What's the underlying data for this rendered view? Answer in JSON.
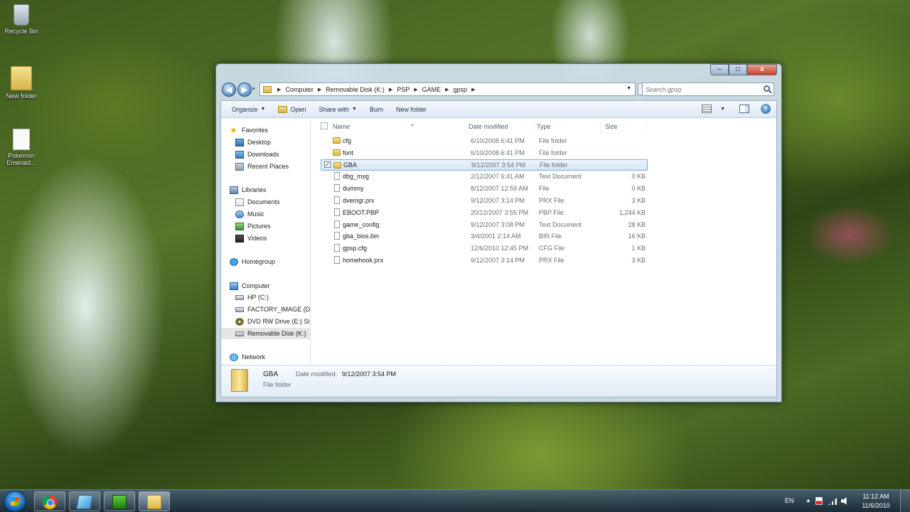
{
  "desktop": {
    "icons": [
      {
        "label": "Recycle Bin"
      },
      {
        "label": "New folder"
      },
      {
        "label": "Pokemon Emerald..."
      }
    ]
  },
  "window": {
    "controls": {
      "minimize": "–",
      "maximize": "□",
      "close": "x"
    },
    "nav": {
      "back": "◀",
      "forward": "▶",
      "recent": "▾"
    },
    "breadcrumb": [
      "Computer",
      "Removable Disk (K:)",
      "PSP",
      "GAME",
      "gpsp"
    ],
    "search_placeholder": "Search gpsp",
    "toolbar": {
      "organize": "Organize",
      "open": "Open",
      "share_with": "Share with",
      "burn": "Burn",
      "new_folder": "New folder",
      "help": "?"
    },
    "nav_pane": {
      "favorites": "Favorites",
      "desktop": "Desktop",
      "downloads": "Downloads",
      "recent_places": "Recent Places",
      "libraries": "Libraries",
      "documents": "Documents",
      "music": "Music",
      "pictures": "Pictures",
      "videos": "Videos",
      "homegroup": "Homegroup",
      "computer": "Computer",
      "hp_c": "HP (C:)",
      "factory_image": "FACTORY_IMAGE (D",
      "dvd_drive": "DVD RW Drive (E:) Si",
      "removable_disk": "Removable Disk (K:)",
      "network": "Network"
    },
    "columns": {
      "name": "Name",
      "date_modified": "Date modified",
      "type": "Type",
      "size": "Size"
    },
    "files": [
      {
        "name": "cfg",
        "date": "6/10/2008 6:41 PM",
        "type": "File folder",
        "size": "",
        "kind": "folder",
        "selected": false
      },
      {
        "name": "font",
        "date": "6/10/2008 6:41 PM",
        "type": "File folder",
        "size": "",
        "kind": "folder",
        "selected": false
      },
      {
        "name": "GBA",
        "date": "9/12/2007 3:54 PM",
        "type": "File folder",
        "size": "",
        "kind": "folder",
        "selected": true
      },
      {
        "name": "dbg_msg",
        "date": "2/12/2007 6:41 AM",
        "type": "Text Document",
        "size": "0 KB",
        "kind": "file",
        "selected": false
      },
      {
        "name": "dummy",
        "date": "8/12/2007 12:59 AM",
        "type": "File",
        "size": "0 KB",
        "kind": "file",
        "selected": false
      },
      {
        "name": "dvemgr.prx",
        "date": "9/12/2007 3:14 PM",
        "type": "PRX File",
        "size": "3 KB",
        "kind": "file",
        "selected": false
      },
      {
        "name": "EBOOT.PBP",
        "date": "20/12/2007 3:55 PM",
        "type": "PBP File",
        "size": "1,244 KB",
        "kind": "file",
        "selected": false
      },
      {
        "name": "game_config",
        "date": "9/12/2007 3:08 PM",
        "type": "Text Document",
        "size": "28 KB",
        "kind": "file",
        "selected": false
      },
      {
        "name": "gba_bios.bin",
        "date": "3/4/2001 2:14 AM",
        "type": "BIN File",
        "size": "16 KB",
        "kind": "file",
        "selected": false
      },
      {
        "name": "gpsp.cfg",
        "date": "12/6/2010 12:45 PM",
        "type": "CFG File",
        "size": "1 KB",
        "kind": "file",
        "selected": false
      },
      {
        "name": "homehook.prx",
        "date": "9/12/2007 3:14 PM",
        "type": "PRX File",
        "size": "3 KB",
        "kind": "file",
        "selected": false
      }
    ],
    "details": {
      "name": "GBA",
      "type": "File folder",
      "modified_label": "Date modified:",
      "modified_value": "9/12/2007 3:54 PM"
    }
  },
  "taskbar": {
    "language": "EN",
    "tray_up": "▲",
    "time": "11:12 AM",
    "date": "11/6/2010"
  }
}
